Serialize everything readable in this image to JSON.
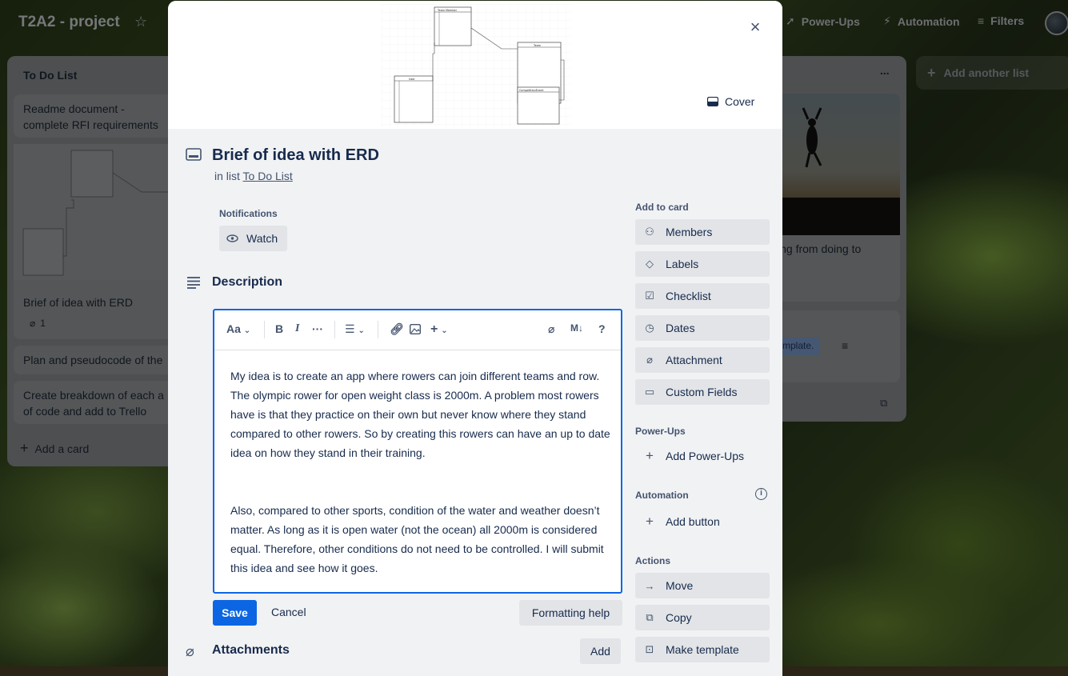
{
  "board": {
    "title": "T2A2 - project",
    "header_buttons": [
      {
        "label": "Power-Ups",
        "icon": "rocket-icon"
      },
      {
        "label": "Automation",
        "icon": "bolt-icon"
      },
      {
        "label": "Filters",
        "icon": "filter-icon"
      }
    ],
    "add_another_list": "Add another list"
  },
  "left_list": {
    "title": "To Do List",
    "cards": [
      {
        "text": "Readme document - complete RFI requirements"
      },
      {
        "text": "Brief of idea with ERD",
        "attachments": "1"
      },
      {
        "text": "Plan and pseudocode of the"
      },
      {
        "text": "Create breakdown of each a of code and add to Trello"
      }
    ],
    "add_card": "Add a card"
  },
  "right_list": {
    "card_text": "ing from doing to",
    "chip": "template.",
    "more": "..."
  },
  "modal": {
    "cover_label": "Cover",
    "close": "×",
    "title": "Brief of idea with ERD",
    "in_list_prefix": "in list",
    "in_list_name": "To Do List",
    "notifications_label": "Notifications",
    "watch_label": "Watch",
    "description_label": "Description",
    "toolbar": {
      "text_style": "Aa",
      "bold": "B",
      "italic": "I",
      "more": "···",
      "markdown": "M↓",
      "help": "?"
    },
    "description_paragraphs": [
      "My idea is to create an app where rowers can join different teams and row. The olympic rower for open weight class is 2000m. A problem most rowers have is that they practice on their own but never know where they stand compared to other rowers. So by creating this rowers can have an up to date idea on how they stand in their training.",
      "Also, compared to other sports, condition of the water and weather doesn’t matter. As long as it is open water (not the ocean) all 2000m is considered equal. Therefore, other conditions do not need to be controlled. I will submit this idea and see how it goes."
    ],
    "save_label": "Save",
    "cancel_label": "Cancel",
    "formatting_help_label": "Formatting help",
    "attachments_label": "Attachments",
    "attachments_add_label": "Add"
  },
  "sidebar": {
    "add_to_card_label": "Add to card",
    "add_to_card": [
      {
        "label": "Members",
        "icon": "person-icon"
      },
      {
        "label": "Labels",
        "icon": "tag-icon"
      },
      {
        "label": "Checklist",
        "icon": "checklist-icon"
      },
      {
        "label": "Dates",
        "icon": "clock-icon"
      },
      {
        "label": "Attachment",
        "icon": "paperclip-icon"
      },
      {
        "label": "Custom Fields",
        "icon": "custom-fields-icon"
      }
    ],
    "power_ups_label": "Power-Ups",
    "add_power_ups": "Add Power-Ups",
    "automation_label": "Automation",
    "add_button": "Add button",
    "actions_label": "Actions",
    "actions": [
      {
        "label": "Move",
        "icon": "arrow-right-icon"
      },
      {
        "label": "Copy",
        "icon": "copy-icon"
      },
      {
        "label": "Make template",
        "icon": "template-icon"
      }
    ]
  },
  "erd": {
    "tables": [
      "Team Member",
      "Team",
      "User",
      "CompetitionEvent"
    ]
  }
}
